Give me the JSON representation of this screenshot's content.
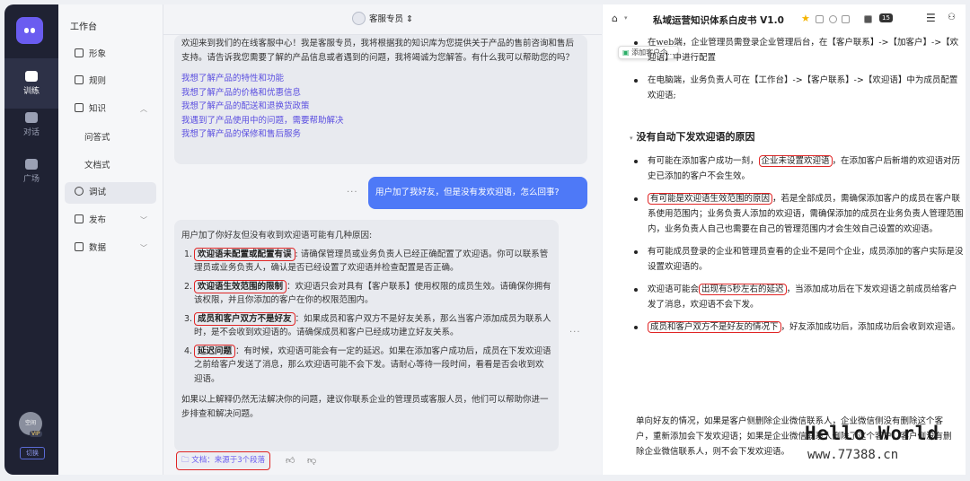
{
  "rail": {
    "items": [
      {
        "label": "训练",
        "icon": "robot-icon"
      },
      {
        "label": "对话",
        "icon": "chat-icon"
      },
      {
        "label": "广场",
        "icon": "grid-icon"
      }
    ],
    "avatar_text": "空间",
    "vip_label": "VIP",
    "switch_label": "切换"
  },
  "menu": {
    "title": "工作台",
    "items": [
      {
        "label": "形象",
        "icon": "person-icon"
      },
      {
        "label": "规则",
        "icon": "edit-icon"
      },
      {
        "label": "知识",
        "icon": "book-icon"
      },
      {
        "label": "问答式"
      },
      {
        "label": "文档式"
      },
      {
        "label": "调试",
        "icon": "chat-bubble-icon"
      },
      {
        "label": "发布",
        "icon": "share-icon"
      },
      {
        "label": "数据",
        "icon": "chart-icon"
      }
    ]
  },
  "chat": {
    "header_title": "客服专员",
    "welcome": "欢迎来到我们的在线客服中心！我是客服专员，我将根据我的知识库为您提供关于产品的售前咨询和售后支持。请告诉我您需要了解的产品信息或者遇到的问题，我将竭诚为您解答。有什么我可以帮助您的吗？",
    "suggestions": [
      "我想了解产品的特性和功能",
      "我想了解产品的价格和优惠信息",
      "我想了解产品的配送和退换货政策",
      "我遇到了产品使用中的问题，需要帮助解决",
      "我想了解产品的保修和售后服务"
    ],
    "user_message": "用户加了我好友，但是没有发欢迎语，怎么回事?",
    "answer_intro": "用户加了你好友但没有收到欢迎语可能有几种原因:",
    "answer_items": [
      {
        "num": "1.",
        "title": "欢迎语未配置或配置有误",
        "text": ": 请确保管理员或业务负责人已经正确配置了欢迎语。你可以联系管理员或业务负责人，确认是否已经设置了欢迎语并检查配置是否正确。"
      },
      {
        "num": "2.",
        "title": "欢迎语生效范围的限制",
        "text": "：欢迎语只会对具有【客户联系】使用权限的成员生效。请确保你拥有该权限，并且你添加的客户在你的权限范围内。"
      },
      {
        "num": "3.",
        "title": "成员和客户双方不是好友",
        "text": "：如果成员和客户双方不是好友关系，那么当客户添加成员为联系人时，是不会收到欢迎语的。请确保成员和客户已经成功建立好友关系。"
      },
      {
        "num": "4.",
        "title": "延迟问题",
        "text": "：有时候，欢迎语可能会有一定的延迟。如果在添加客户成功后，成员在下发欢迎语之前给客户发送了消息，那么欢迎语可能不会下发。请耐心等待一段时间，看看是否会收到欢迎语。"
      }
    ],
    "answer_outro": "如果以上解释仍然无法解决你的问题，建议你联系企业的管理员或客服人员，他们可以帮助你进一步排查和解决问题。",
    "doc_ref": "文档：来源于3个段落"
  },
  "doc": {
    "title": "私域运营知识体系白皮书 V1.0",
    "badge": "15",
    "tooltip": "添加客户个...",
    "top_bullets": [
      "在web端，企业管理员需登录企业管理后台，在【客户联系】->【加客户】->【欢迎语】中进行配置",
      "在电脑端，业务负责人可在【工作台】->【客户联系】->【欢迎语】中为成员配置欢迎语;"
    ],
    "heading": "没有自动下发欢迎语的原因",
    "reasons": [
      {
        "pre": "有可能在添加客户成功一刻，",
        "hl": "企业未设置欢迎语",
        "post": "，在添加客户后新增的欢迎语对历史已添加的客户不会生效。"
      },
      {
        "pre": "",
        "hl": "有可能是欢迎语生效范围的原因",
        "post": "，若是全部成员，需确保添加客户的成员在客户联系使用范围内；业务负责人添加的欢迎语，需确保添加的成员在业务负责人管理范围内，业务负责人自己也需要在自己的管理范围内才会生效自己设置的欢迎语。"
      },
      {
        "pre": "有可能成员登录的企业和管理员查看的企业不是同个企业，成员添加的客户实际是没设置欢迎语的。",
        "hl": "",
        "post": ""
      },
      {
        "pre": "欢迎语可能会",
        "hl": "出现有5秒左右的延迟",
        "post": "，当添加成功后在下发欢迎语之前成员给客户发了消息，欢迎语不会下发。"
      },
      {
        "pre": "",
        "hl": "成员和客户双方不是好友的情况下",
        "post": "，好友添加成功后，添加成功后会收到欢迎语。"
      }
    ],
    "trailing_para": "单向好友的情况，如果是客户侧删除企业微信联系人，企业微信侧没有删除这个客户，重新添加会下发欢迎语；如果是企业微信联系人删除了这个客户，客户侧没有删除企业微信联系人，则不会下发欢迎语。",
    "watermark_line1": "Hello World",
    "watermark_line2": "www.77388.cn"
  }
}
